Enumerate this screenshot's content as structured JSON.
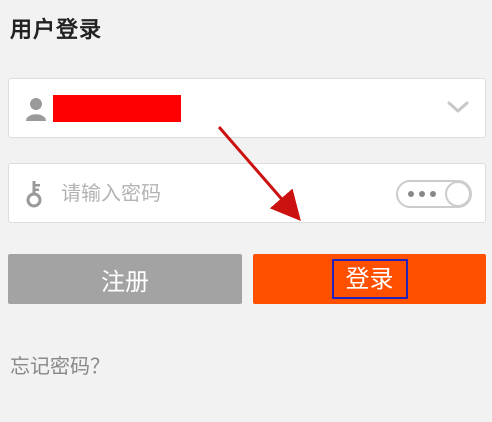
{
  "page": {
    "title": "用户登录"
  },
  "username_field": {
    "value_redacted": true,
    "dropdown_icon": "chevron-down-icon",
    "leading_icon": "user-icon"
  },
  "password_field": {
    "placeholder": "请输入密码",
    "leading_icon": "key-icon",
    "visibility_toggle": "password-visibility-toggle"
  },
  "buttons": {
    "register_label": "注册",
    "login_label": "登录"
  },
  "links": {
    "forgot_password": "忘记密码？"
  },
  "colors": {
    "login_button": "#ff5000",
    "register_button": "#a3a3a3",
    "redaction": "#ff0000",
    "annotation_arrow": "#cc1111",
    "highlight_box": "#2222bb"
  }
}
